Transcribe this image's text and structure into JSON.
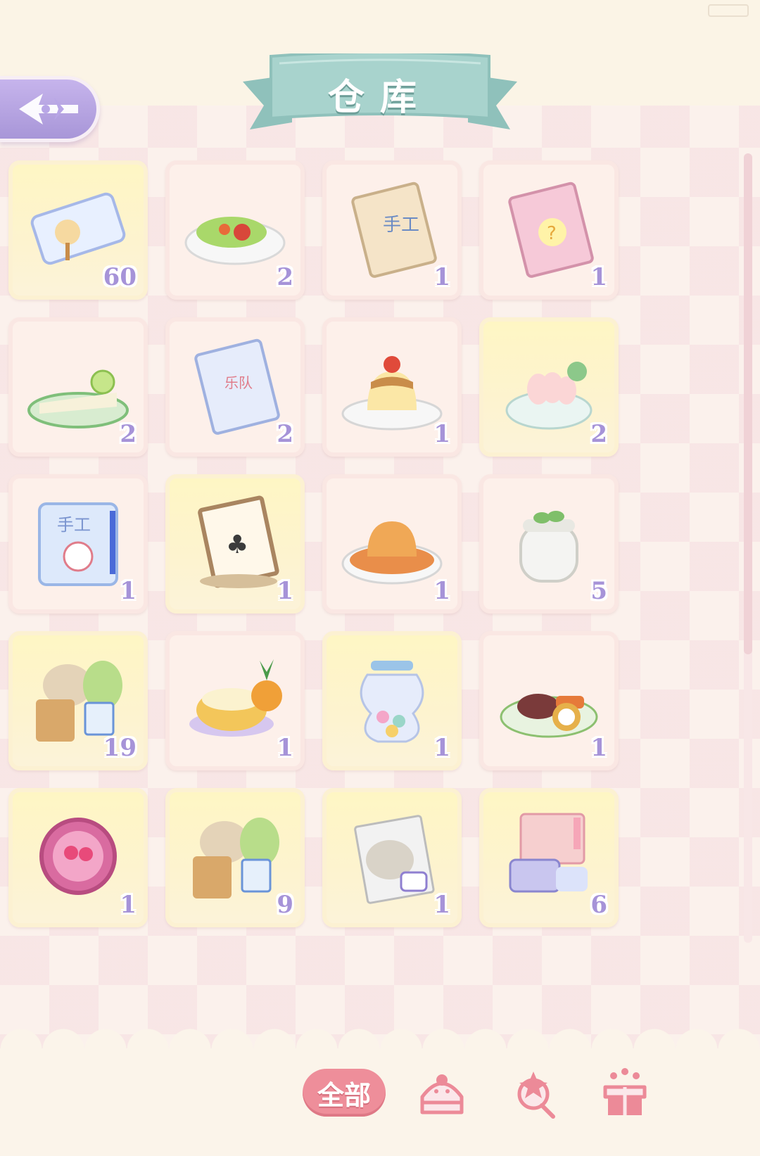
{
  "title": "仓库",
  "back_button": {
    "icon": "arrow-left-icon"
  },
  "items": [
    {
      "icon": "ticket-icon",
      "count": "60",
      "gold": true
    },
    {
      "icon": "wrap-dish-icon",
      "count": "2",
      "gold": false
    },
    {
      "icon": "handcraft-book-icon",
      "count": "1",
      "gold": false
    },
    {
      "icon": "art-book-icon",
      "count": "1",
      "gold": false
    },
    {
      "icon": "lime-cake-icon",
      "count": "2",
      "gold": false
    },
    {
      "icon": "band-book-icon",
      "count": "2",
      "gold": false
    },
    {
      "icon": "pudding-icon",
      "count": "1",
      "gold": false
    },
    {
      "icon": "shrimp-salad-icon",
      "count": "2",
      "gold": true
    },
    {
      "icon": "craft-notebook-icon",
      "count": "1",
      "gold": false
    },
    {
      "icon": "playing-card-frame-icon",
      "count": "1",
      "gold": true
    },
    {
      "icon": "caramel-flan-icon",
      "count": "1",
      "gold": false
    },
    {
      "icon": "yogurt-jar-icon",
      "count": "5",
      "gold": false
    },
    {
      "icon": "grocery-bundle-icon",
      "count": "19",
      "gold": true
    },
    {
      "icon": "pineapple-dessert-icon",
      "count": "1",
      "gold": false
    },
    {
      "icon": "candy-jar-icon",
      "count": "1",
      "gold": true
    },
    {
      "icon": "meat-salad-icon",
      "count": "1",
      "gold": false
    },
    {
      "icon": "badge-icon",
      "count": "1",
      "gold": true
    },
    {
      "icon": "grocery-bundle-icon",
      "count": "9",
      "gold": true
    },
    {
      "icon": "flour-bag-icon",
      "count": "1",
      "gold": true
    },
    {
      "icon": "art-supplies-icon",
      "count": "6",
      "gold": true
    }
  ],
  "tabs": {
    "all_label": "全部",
    "icons": [
      "cake-tab-icon",
      "ornament-tab-icon",
      "gift-box-tab-icon"
    ]
  },
  "colors": {
    "accent_purple": "#a693d8",
    "tab_pink": "#ee8e9a",
    "banner_teal": "#a8d3cd"
  }
}
